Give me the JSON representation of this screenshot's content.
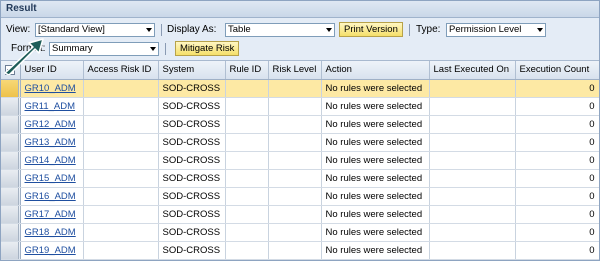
{
  "panel": {
    "title": "Result"
  },
  "toolbar": {
    "view_label": "View:",
    "view_value": "[Standard View]",
    "display_as_label": "Display As:",
    "display_as_value": "Table",
    "print_version_label": "Print Version",
    "type_label": "Type:",
    "type_value": "Permission Level",
    "format_label": "Format:",
    "format_value": "Summary",
    "mitigate_risk_label": "Mitigate Risk"
  },
  "table": {
    "columns": [
      "User ID",
      "Access Risk ID",
      "System",
      "Rule ID",
      "Risk Level",
      "Action",
      "Last Executed On",
      "Execution Count"
    ],
    "rows": [
      {
        "user_id": "GR10_ADM",
        "access_risk_id": "",
        "system": "SOD-CROSS",
        "rule_id": "",
        "risk_level": "",
        "action": "No rules were selected",
        "last_executed_on": "",
        "execution_count": "0"
      },
      {
        "user_id": "GR11_ADM",
        "access_risk_id": "",
        "system": "SOD-CROSS",
        "rule_id": "",
        "risk_level": "",
        "action": "No rules were selected",
        "last_executed_on": "",
        "execution_count": "0"
      },
      {
        "user_id": "GR12_ADM",
        "access_risk_id": "",
        "system": "SOD-CROSS",
        "rule_id": "",
        "risk_level": "",
        "action": "No rules were selected",
        "last_executed_on": "",
        "execution_count": "0"
      },
      {
        "user_id": "GR13_ADM",
        "access_risk_id": "",
        "system": "SOD-CROSS",
        "rule_id": "",
        "risk_level": "",
        "action": "No rules were selected",
        "last_executed_on": "",
        "execution_count": "0"
      },
      {
        "user_id": "GR14_ADM",
        "access_risk_id": "",
        "system": "SOD-CROSS",
        "rule_id": "",
        "risk_level": "",
        "action": "No rules were selected",
        "last_executed_on": "",
        "execution_count": "0"
      },
      {
        "user_id": "GR15_ADM",
        "access_risk_id": "",
        "system": "SOD-CROSS",
        "rule_id": "",
        "risk_level": "",
        "action": "No rules were selected",
        "last_executed_on": "",
        "execution_count": "0"
      },
      {
        "user_id": "GR16_ADM",
        "access_risk_id": "",
        "system": "SOD-CROSS",
        "rule_id": "",
        "risk_level": "",
        "action": "No rules were selected",
        "last_executed_on": "",
        "execution_count": "0"
      },
      {
        "user_id": "GR17_ADM",
        "access_risk_id": "",
        "system": "SOD-CROSS",
        "rule_id": "",
        "risk_level": "",
        "action": "No rules were selected",
        "last_executed_on": "",
        "execution_count": "0"
      },
      {
        "user_id": "GR18_ADM",
        "access_risk_id": "",
        "system": "SOD-CROSS",
        "rule_id": "",
        "risk_level": "",
        "action": "No rules were selected",
        "last_executed_on": "",
        "execution_count": "0"
      },
      {
        "user_id": "GR19_ADM",
        "access_risk_id": "",
        "system": "SOD-CROSS",
        "rule_id": "",
        "risk_level": "",
        "action": "No rules were selected",
        "last_executed_on": "",
        "execution_count": "0"
      }
    ],
    "selected_row_index": 0
  },
  "icons": {
    "table_settings": "table-settings-icon",
    "annotation_arrow": "arrow-pointer-icon"
  },
  "colors": {
    "highlight_row": "#fde9a4",
    "link": "#1f4fa0",
    "button": "#f5df6a",
    "header_bg": "#dfe8f3",
    "arrow": "#1f5e59"
  }
}
